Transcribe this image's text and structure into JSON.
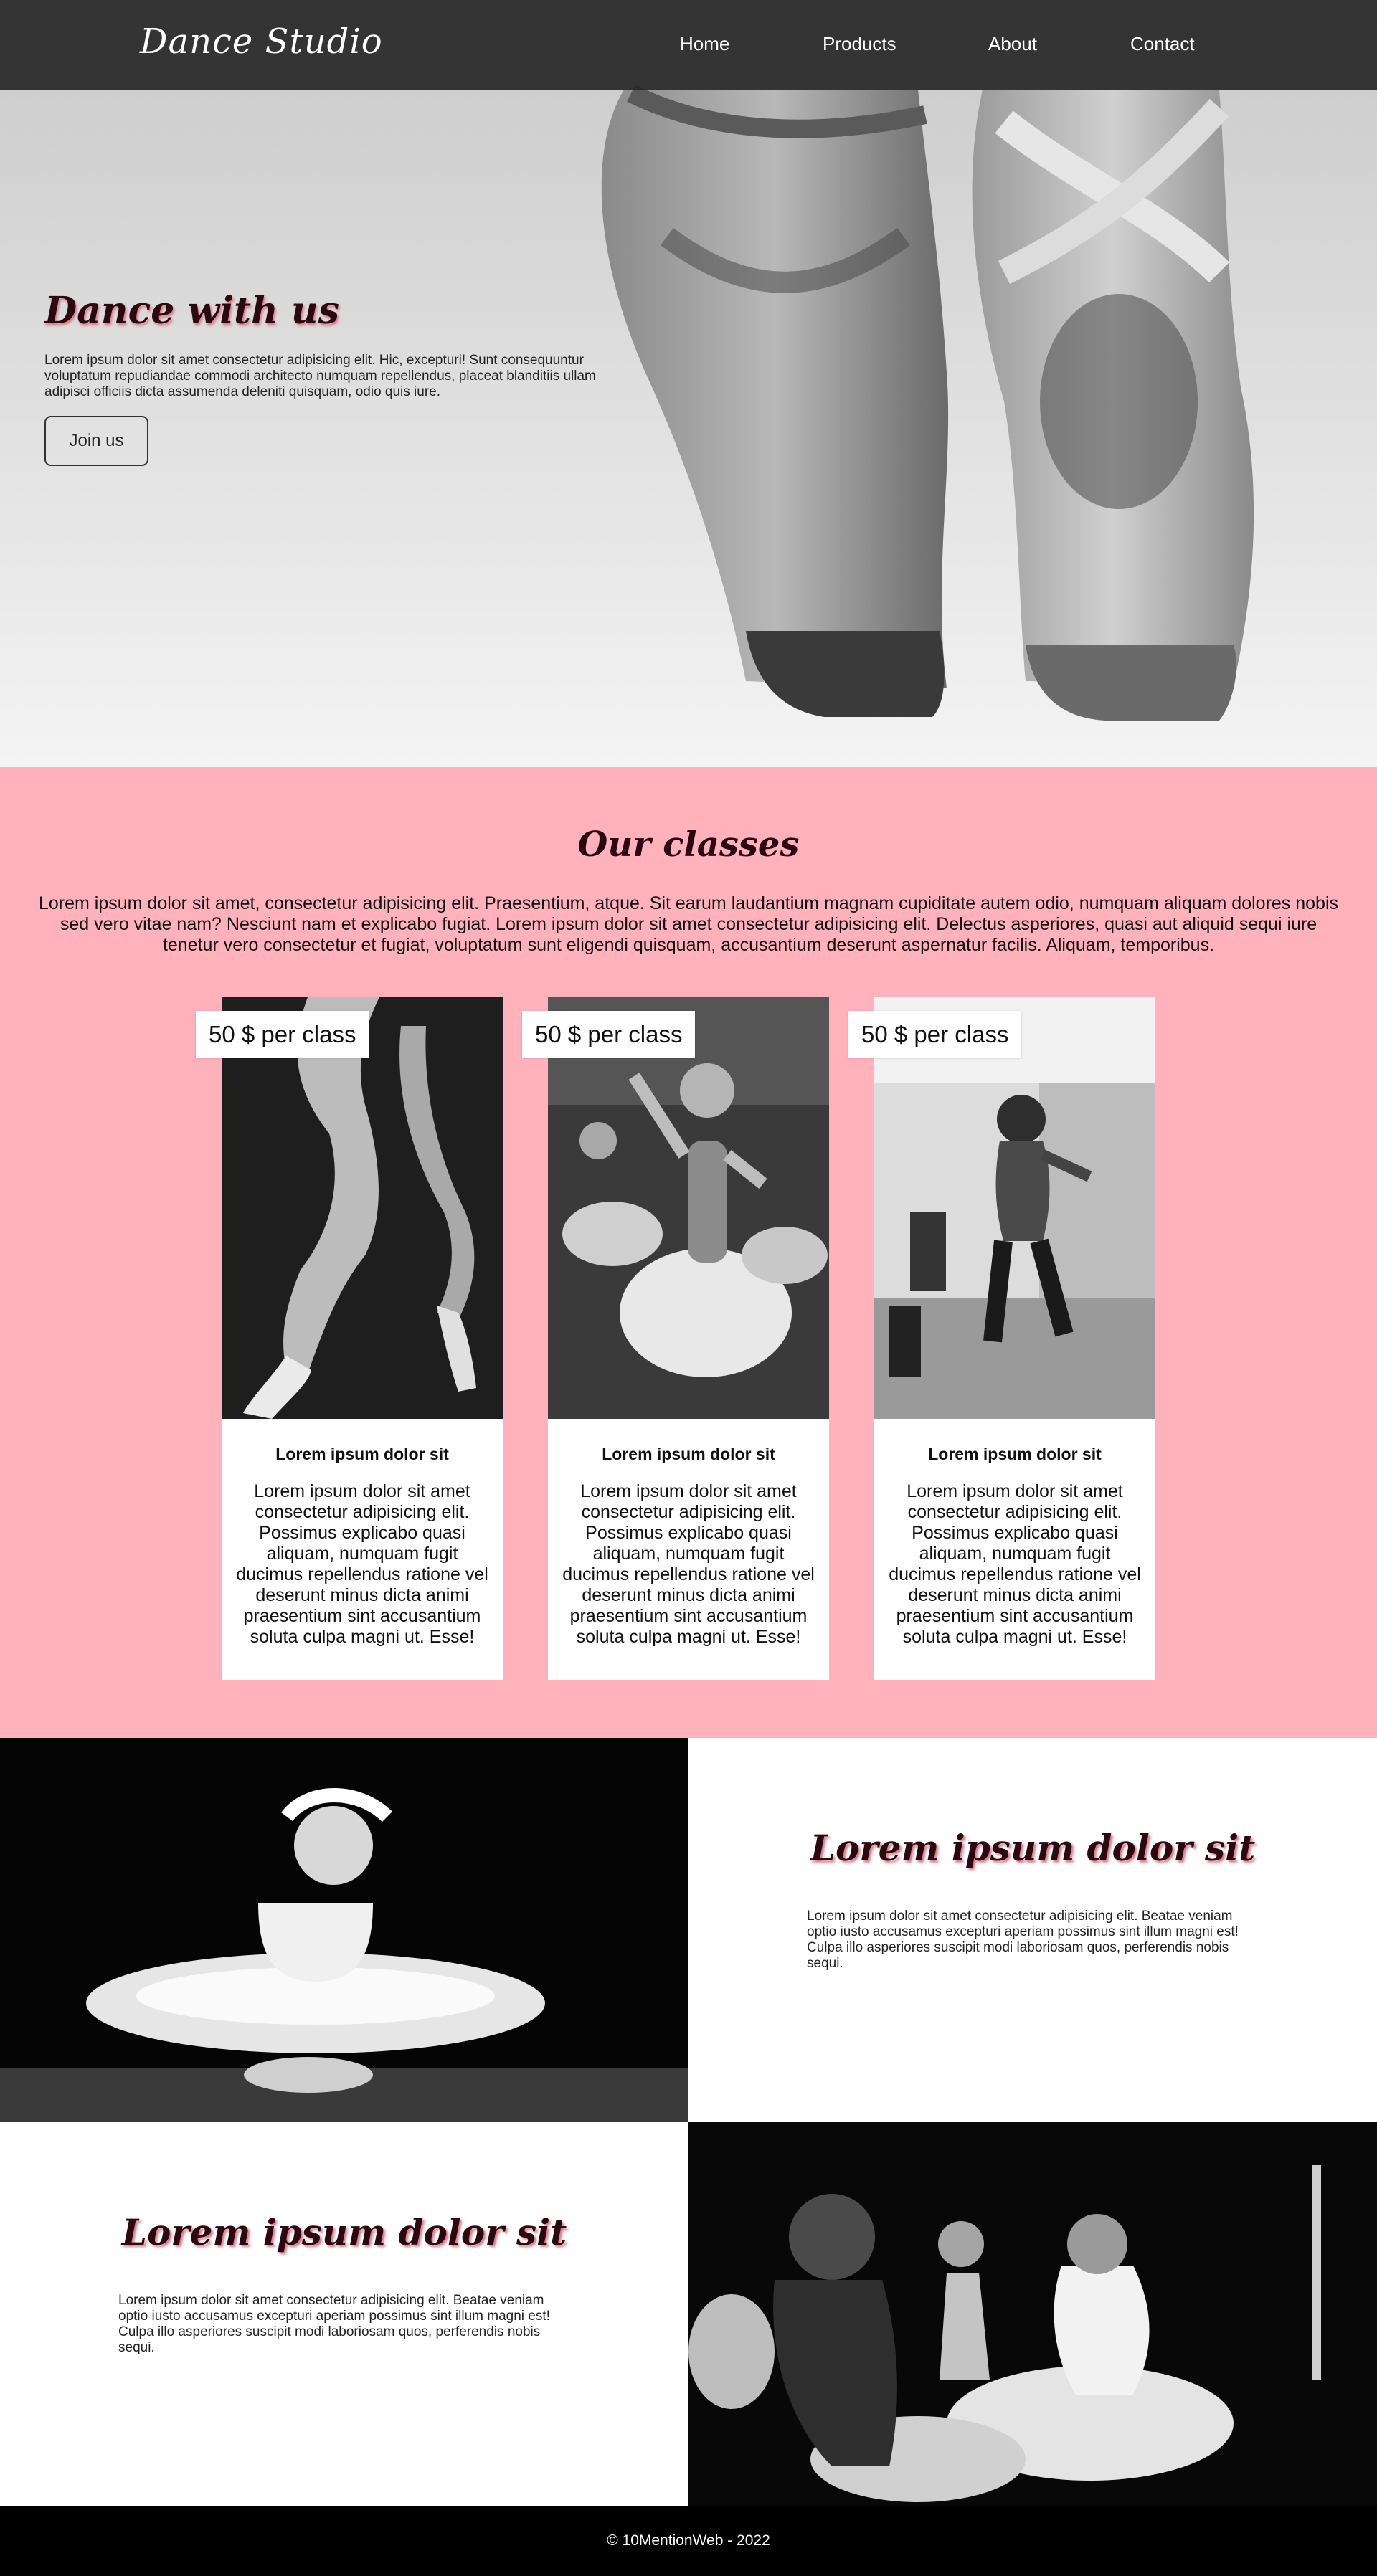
{
  "header": {
    "logo": "Dance Studio",
    "nav": [
      "Home",
      "Products",
      "About",
      "Contact"
    ]
  },
  "hero": {
    "title": "Dance with us",
    "text": "Lorem ipsum dolor sit amet consectetur adipisicing elit. Hic, excepturi! Sunt consequuntur voluptatum repudiandae commodi architecto numquam repellendus, placeat blanditiis ullam adipisci officiis dicta assumenda deleniti quisquam, odio quis iure.",
    "button": "Join us"
  },
  "classes": {
    "title": "Our classes",
    "text": "Lorem ipsum dolor sit amet, consectetur adipisicing elit. Praesentium, atque. Sit earum laudantium magnam cupiditate autem odio, numquam aliquam dolores nobis sed vero vitae nam? Nesciunt nam et explicabo fugiat. Lorem ipsum dolor sit amet consectetur adipisicing elit. Delectus asperiores, quasi aut aliquid sequi iure tenetur vero consectetur et fugiat, voluptatum sunt eligendi quisquam, accusantium deserunt aspernatur facilis. Aliquam, temporibus.",
    "cards": [
      {
        "price": "50 $ per class",
        "title": "Lorem ipsum dolor sit",
        "text": "Lorem ipsum dolor sit amet consectetur adipisicing elit. Possimus explicabo quasi aliquam, numquam fugit ducimus repellendus ratione vel deserunt minus dicta animi praesentium sint accusantium soluta culpa magni ut. Esse!"
      },
      {
        "price": "50 $ per class",
        "title": "Lorem ipsum dolor sit",
        "text": "Lorem ipsum dolor sit amet consectetur adipisicing elit. Possimus explicabo quasi aliquam, numquam fugit ducimus repellendus ratione vel deserunt minus dicta animi praesentium sint accusantium soluta culpa magni ut. Esse!"
      },
      {
        "price": "50 $ per class",
        "title": "Lorem ipsum dolor sit",
        "text": "Lorem ipsum dolor sit amet consectetur adipisicing elit. Possimus explicabo quasi aliquam, numquam fugit ducimus repellendus ratione vel deserunt minus dicta animi praesentium sint accusantium soluta culpa magni ut. Esse!"
      }
    ]
  },
  "features": [
    {
      "title": "Lorem ipsum dolor sit",
      "text": "Lorem ipsum dolor sit amet consectetur adipisicing elit. Beatae veniam optio iusto accusamus excepturi aperiam possimus sint illum magni est! Culpa illo asperiores suscipit modi laboriosam quos, perferendis nobis sequi."
    },
    {
      "title": "Lorem ipsum dolor sit",
      "text": "Lorem ipsum dolor sit amet consectetur adipisicing elit. Beatae veniam optio iusto accusamus excepturi aperiam possimus sint illum magni est! Culpa illo asperiores suscipit modi laboriosam quos, perferendis nobis sequi."
    }
  ],
  "footer": {
    "text": "© 10MentionWeb - 2022"
  },
  "colors": {
    "pink": "#ffb1bc",
    "header": "#282828",
    "title": "#2a0a10",
    "shadow": "#d87a8a"
  }
}
